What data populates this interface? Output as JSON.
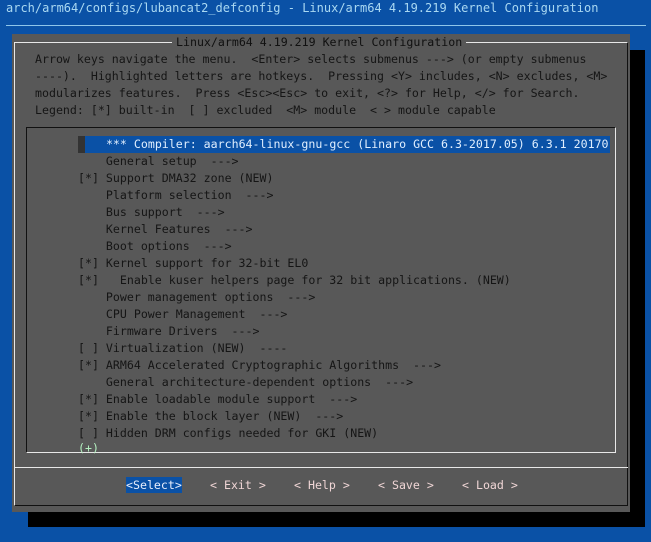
{
  "window_title": "arch/arm64/configs/lubancat2_defconfig - Linux/arm64 4.19.219 Kernel Configuration",
  "dialog": {
    "title": "Linux/arm64 4.19.219 Kernel Configuration",
    "help_lines": [
      "Arrow keys navigate the menu.  <Enter> selects submenus ---> (or empty submenus",
      "----).  Highlighted letters are hotkeys.  Pressing <Y> includes, <N> excludes, <M>",
      "modularizes features.  Press <Esc><Esc> to exit, <?> for Help, </> for Search.",
      "Legend: [*] built-in  [ ] excluded  <M> module  < > module capable"
    ]
  },
  "menu": {
    "items": [
      {
        "prefix": "",
        "label": "*** Compiler: aarch64-linux-gnu-gcc (Linaro GCC 6.3-2017.05) 6.3.1 20170",
        "selected": true
      },
      {
        "prefix": "    ",
        "label": "General setup  --->"
      },
      {
        "prefix": "[*] ",
        "label": "Support DMA32 zone (NEW)"
      },
      {
        "prefix": "    ",
        "label": "Platform selection  --->"
      },
      {
        "prefix": "    ",
        "label": "Bus support  --->"
      },
      {
        "prefix": "    ",
        "label": "Kernel Features  --->"
      },
      {
        "prefix": "    ",
        "label": "Boot options  --->"
      },
      {
        "prefix": "[*] ",
        "label": "Kernel support for 32-bit EL0"
      },
      {
        "prefix": "[*] ",
        "label": "  Enable kuser helpers page for 32 bit applications. (NEW)"
      },
      {
        "prefix": "    ",
        "label": "Power management options  --->"
      },
      {
        "prefix": "    ",
        "label": "CPU Power Management  --->"
      },
      {
        "prefix": "    ",
        "label": "Firmware Drivers  --->"
      },
      {
        "prefix": "[ ] ",
        "label": "Virtualization (NEW)  ----"
      },
      {
        "prefix": "[*] ",
        "label": "ARM64 Accelerated Cryptographic Algorithms  --->"
      },
      {
        "prefix": "    ",
        "label": "General architecture-dependent options  --->"
      },
      {
        "prefix": "[*] ",
        "label": "Enable loadable module support  --->"
      },
      {
        "prefix": "[*] ",
        "label": "Enable the block layer (NEW)  --->"
      },
      {
        "prefix": "[ ] ",
        "label": "Hidden DRM configs needed for GKI (NEW)"
      }
    ],
    "more_indicator": "(+)"
  },
  "buttons": [
    {
      "label": "<Select>",
      "selected": true
    },
    {
      "label": "< Exit >"
    },
    {
      "label": "< Help >"
    },
    {
      "label": "< Save >"
    },
    {
      "label": "< Load >"
    }
  ]
}
